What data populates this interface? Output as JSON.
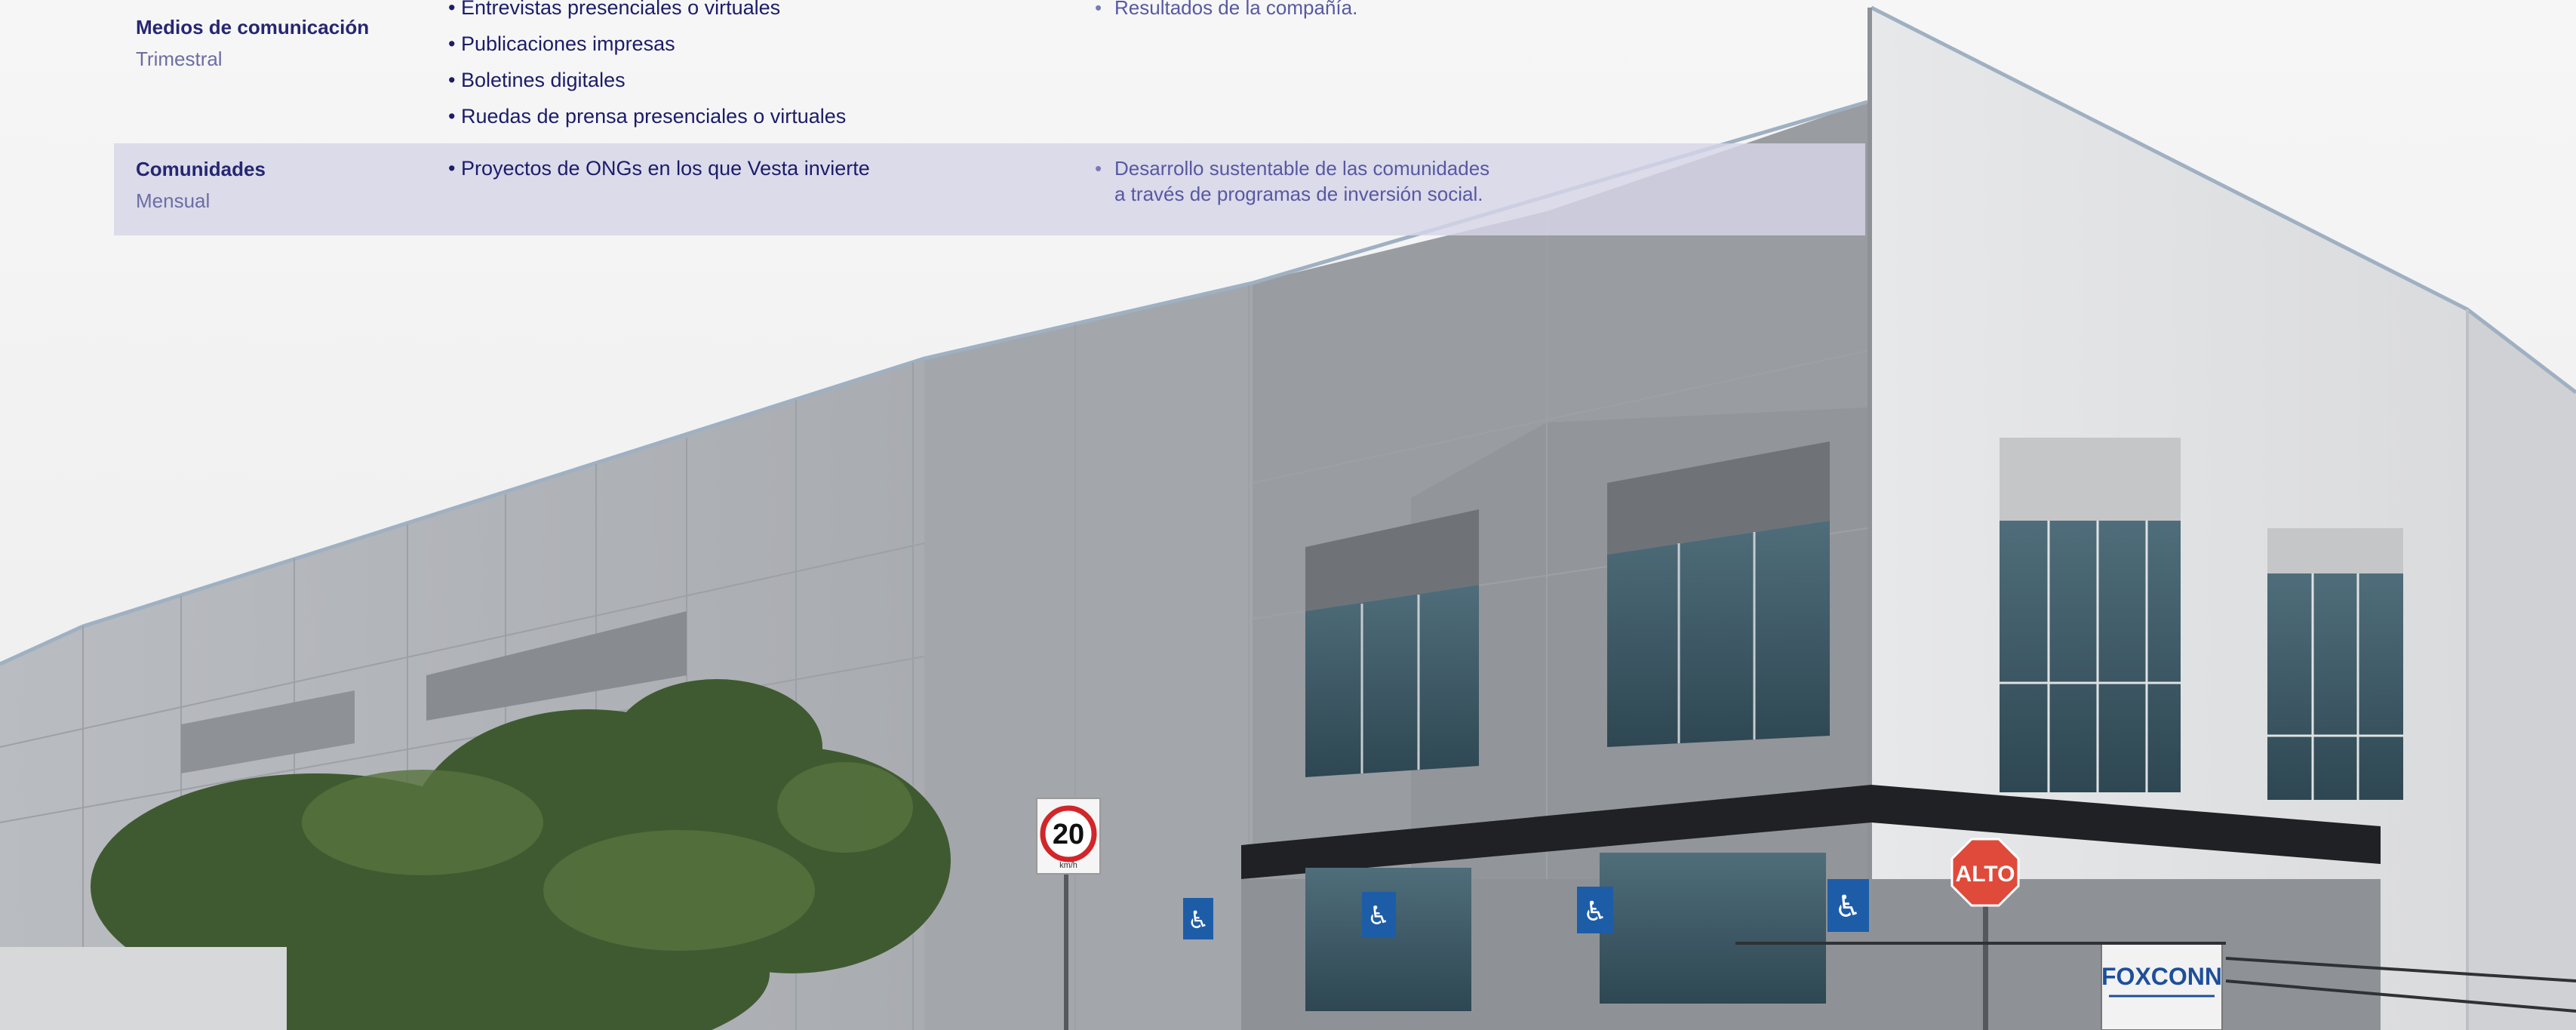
{
  "colors": {
    "group_name": "#262673",
    "frequency": "#6d6da6",
    "channel_text": "#1c1c6a",
    "topic_text": "#5858a3",
    "highlight_row": "#d6d6e8"
  },
  "table": {
    "rows": [
      {
        "group": "Medios de comunicación",
        "frequency": "Trimestral",
        "channels": [
          "• Entrevistas presenciales o virtuales",
          "• Publicaciones impresas",
          "• Boletines digitales",
          "• Ruedas de prensa presenciales o virtuales"
        ],
        "topics": [
          "Resultados de la compañía."
        ]
      },
      {
        "group": "Comunidades",
        "frequency": "Mensual",
        "channels": [
          "• Proyectos de ONGs en los que Vesta invierte"
        ],
        "topics": [
          "Desarrollo sustentable de las comunidades",
          "a través de programas de inversión social."
        ]
      }
    ]
  },
  "photo": {
    "speed_sign": "20",
    "speed_unit": "km/h",
    "stop_sign": "ALTO",
    "company_sign": "FOXCONN"
  }
}
